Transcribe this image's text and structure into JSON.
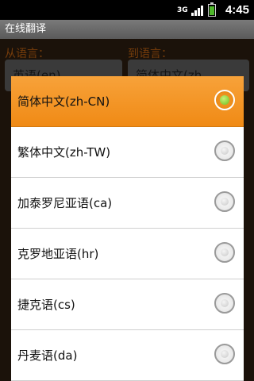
{
  "status_bar": {
    "network": "3G",
    "time": "4:45",
    "signal_icon": "signal-icon",
    "battery_icon": "battery-icon"
  },
  "app": {
    "title": "在线翻译",
    "from_label": "从语言：",
    "to_label": "到语言：",
    "from_value": "英语(en)",
    "to_value": "简体中文(zh"
  },
  "dialog": {
    "selected_index": 0,
    "items": [
      {
        "label": "简体中文(zh-CN)",
        "selected": true
      },
      {
        "label": "繁体中文(zh-TW)",
        "selected": false
      },
      {
        "label": "加泰罗尼亚语(ca)",
        "selected": false
      },
      {
        "label": "克罗地亚语(hr)",
        "selected": false
      },
      {
        "label": "捷克语(cs)",
        "selected": false
      },
      {
        "label": "丹麦语(da)",
        "selected": false
      }
    ]
  },
  "colors": {
    "accent": "#f39a2a",
    "selected_dot": "#7fcc2a",
    "label_orange": "#b35c12"
  }
}
